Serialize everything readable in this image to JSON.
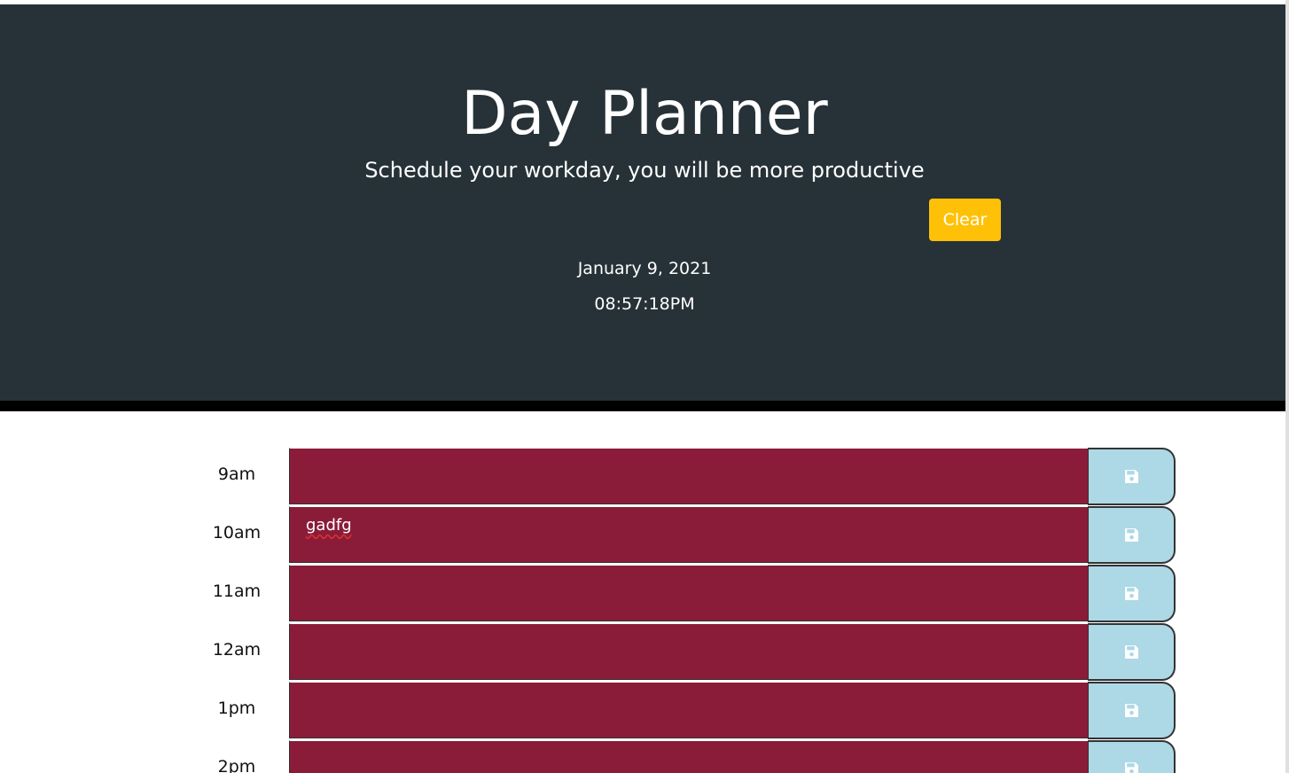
{
  "header": {
    "title": "Day Planner",
    "subtitle": "Schedule your workday, you will be more productive",
    "clear_label": "Clear",
    "date": "January 9, 2021",
    "time": "08:57:18PM"
  },
  "rows": [
    {
      "hour": "9am",
      "text": ""
    },
    {
      "hour": "10am",
      "text": "gadfg"
    },
    {
      "hour": "11am",
      "text": ""
    },
    {
      "hour": "12am",
      "text": ""
    },
    {
      "hour": "1pm",
      "text": ""
    },
    {
      "hour": "2pm",
      "text": ""
    }
  ],
  "icons": {
    "save": "floppy-disk-icon"
  },
  "colors": {
    "header_bg": "#263238",
    "past_row": "#8a1c39",
    "save_button": "#add8e6",
    "clear_button": "#ffc107"
  }
}
